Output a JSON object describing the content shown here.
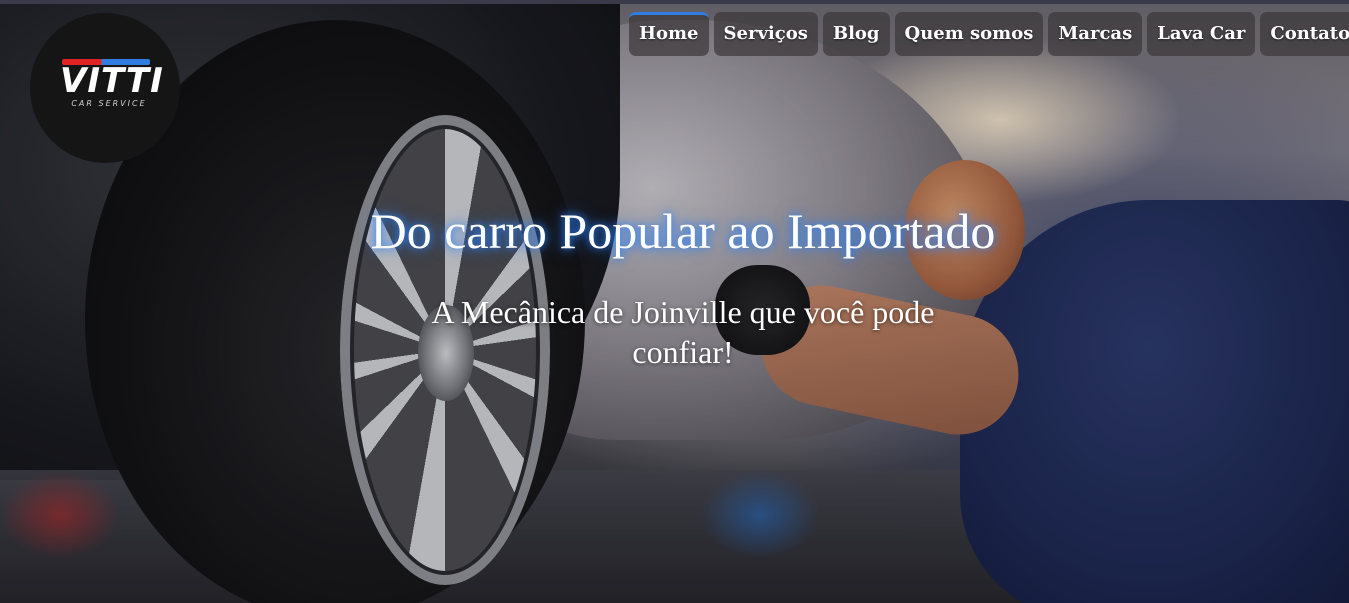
{
  "brand": {
    "logo_text": "VITTI",
    "logo_subtext": "CAR SERVICE",
    "accent_red": "#e02424",
    "accent_blue": "#2f7de0"
  },
  "nav": {
    "items": [
      {
        "label": "Home",
        "active": true
      },
      {
        "label": "Serviços",
        "active": false
      },
      {
        "label": "Blog",
        "active": false
      },
      {
        "label": "Quem somos",
        "active": false
      },
      {
        "label": "Marcas",
        "active": false
      },
      {
        "label": "Lava Car",
        "active": false
      },
      {
        "label": "Contatos",
        "active": false
      }
    ]
  },
  "hero": {
    "title": "Do carro Popular ao Importado",
    "subtitle": "A Mecânica de Joinville que você pode confiar!",
    "image_subject": "mechanic changing a car tire in a workshop"
  }
}
